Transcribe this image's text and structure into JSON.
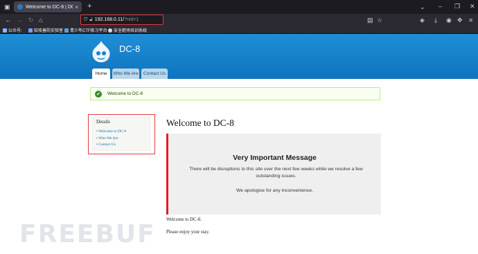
{
  "browser": {
    "tab_title": "Welcome to DC-8 | DC-8",
    "tab_close": "×",
    "new_tab": "+",
    "url_host": "192.168.0.11/",
    "url_query": "?nid=1",
    "bookmarks": [
      "公众号:",
      "知攻善防实验室",
      "青少年CTF练习平台",
      "安全靶场培训系统"
    ]
  },
  "site": {
    "name": "DC-8",
    "nav": [
      "Home",
      "Who We Are",
      "Contact Us"
    ],
    "status_message": "Welcome to DC-8"
  },
  "sidebar": {
    "heading": "Details",
    "links": [
      "Welcome to DC-8",
      "Who We Are",
      "Contact Us"
    ]
  },
  "main": {
    "title": "Welcome to DC-8",
    "box_heading": "Very Important Message",
    "box_text": "There will be disruptions to this site over the next few weeks while we resolve a few outstanding issues.",
    "box_apology": "We apologise for any inconvenience.",
    "para1": "Welcome to DC-8.",
    "para2": "Please enjoy your stay."
  },
  "watermark": "FREEBUF",
  "colors": {
    "header_blue": "#1580c9",
    "highlight_red": "#e03a3e",
    "status_green": "#3a8a2c"
  }
}
